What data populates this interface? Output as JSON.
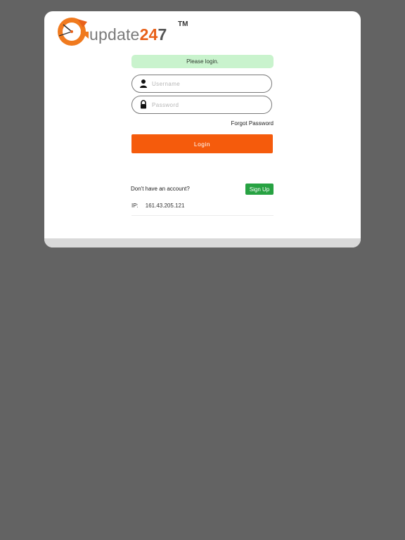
{
  "logo": {
    "text_prefix": "update",
    "text_num": "24",
    "text_num7": "7",
    "tm": "TM",
    "accent_color": "#e8611a"
  },
  "alert": {
    "message": "Please login.",
    "color": "#c9f3cd"
  },
  "form": {
    "username_placeholder": "Username",
    "username_value": "",
    "username_icon": "user-icon",
    "password_placeholder": "Password",
    "password_value": "",
    "password_icon": "lock-icon",
    "forgot_label": "Forgot Password",
    "login_label": "Login",
    "login_color": "#f55b0c"
  },
  "signup": {
    "prompt": "Don't have an account?",
    "button_label": "Sign Up",
    "button_color": "#27a242"
  },
  "ip": {
    "label": "IP:",
    "value": "161.43.205.121"
  }
}
